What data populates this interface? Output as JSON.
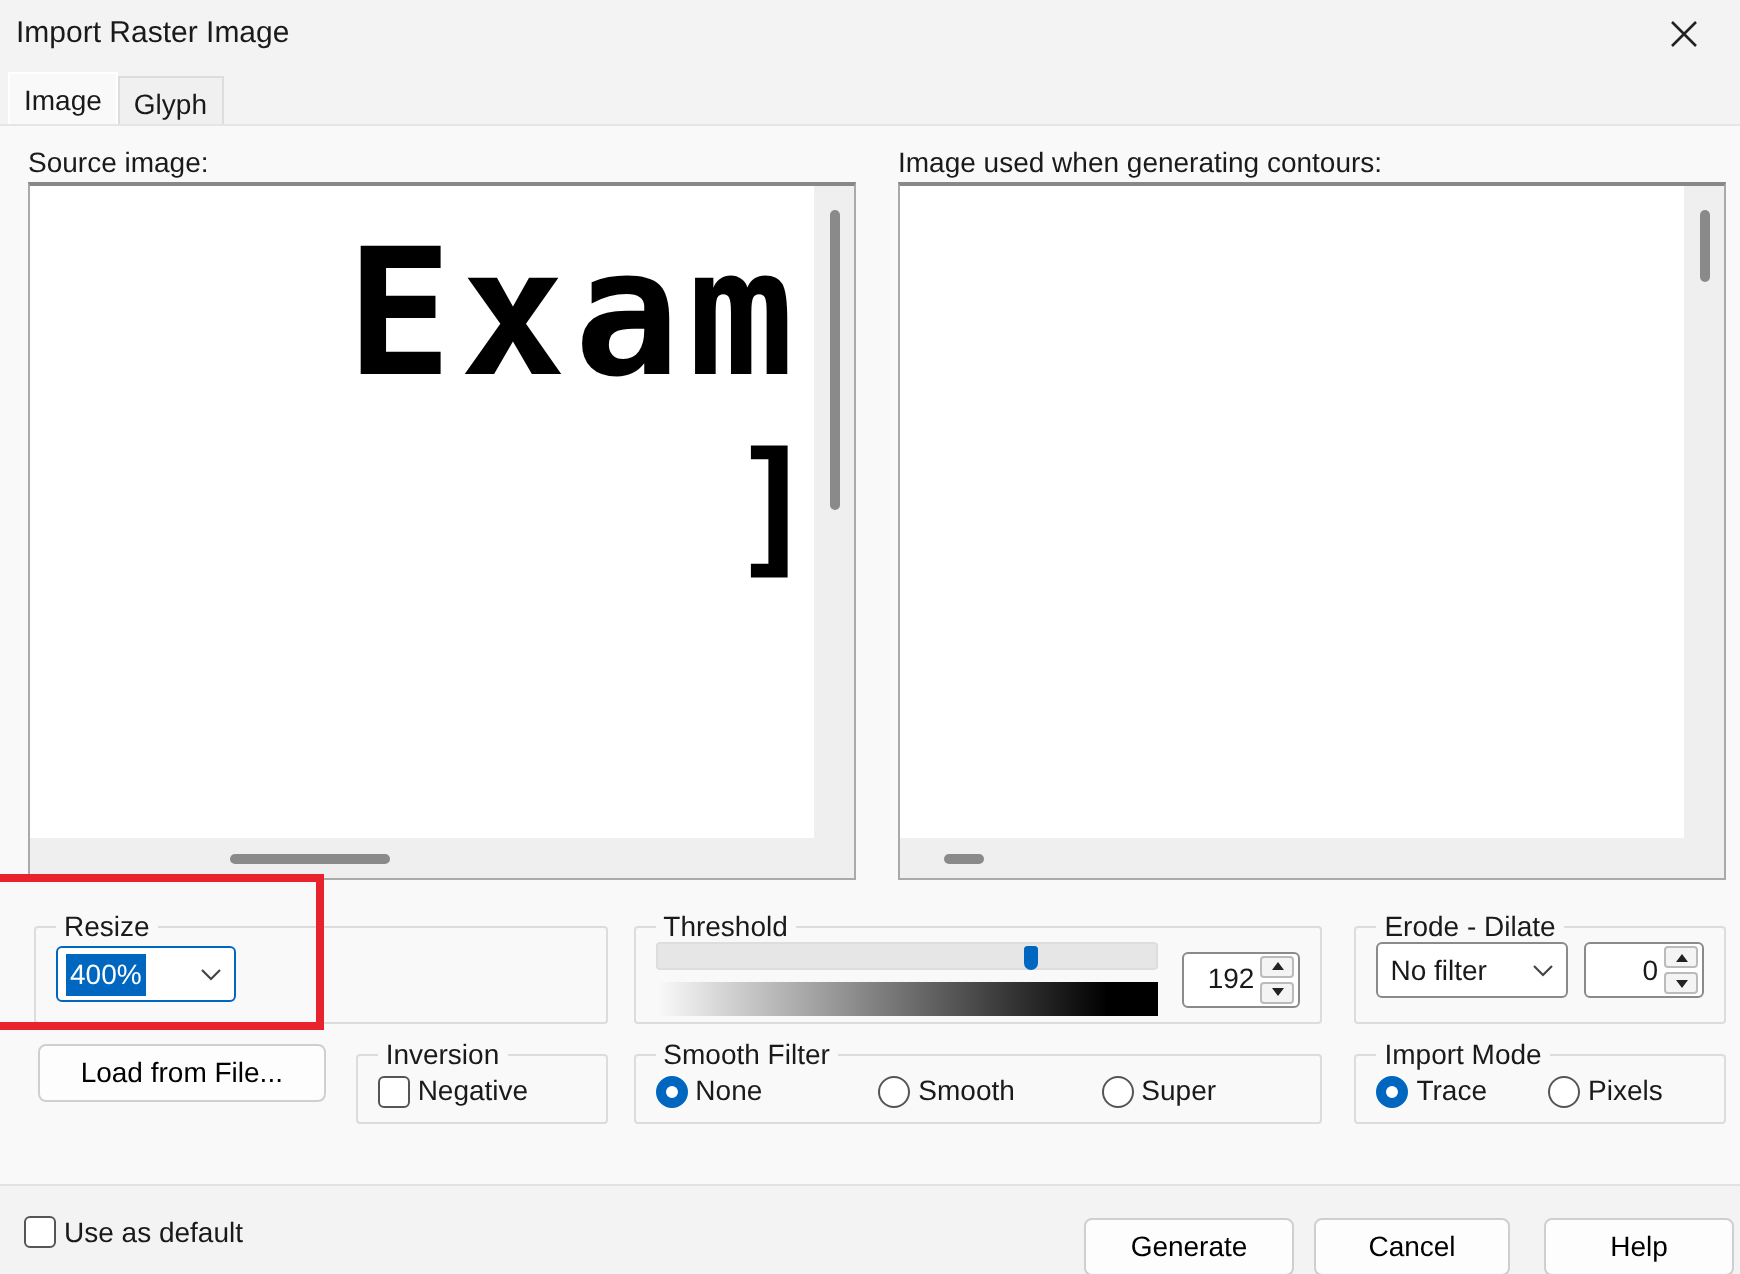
{
  "window": {
    "title": "Import Raster Image"
  },
  "tabs": [
    {
      "label": "Image",
      "selected": true
    },
    {
      "label": "Glyph",
      "selected": false
    }
  ],
  "previews": [
    {
      "label": "Source image:",
      "lines": [
        "Exam",
        "]"
      ]
    },
    {
      "label": "Image used when generating contours:"
    }
  ],
  "resize": {
    "label": "Resize",
    "value": "400%",
    "text_selected": true,
    "highlighted": true
  },
  "threshold": {
    "label": "Threshold",
    "level": 0.75,
    "value": "192"
  },
  "erode_dilate": {
    "label": "Erode - Dilate",
    "filter": "No filter",
    "value": "0"
  },
  "load_button": "Load from File...",
  "inversion": {
    "label": "Inversion",
    "options": [
      {
        "label": "Negative",
        "checked": false
      }
    ]
  },
  "smooth_filter": {
    "label": "Smooth Filter",
    "options": [
      {
        "label": "None",
        "selected": true
      },
      {
        "label": "Smooth",
        "selected": false
      },
      {
        "label": "Super",
        "selected": false
      }
    ]
  },
  "import_mode": {
    "label": "Import Mode",
    "options": [
      {
        "label": "Trace",
        "selected": true
      },
      {
        "label": "Pixels",
        "selected": false
      }
    ]
  },
  "use_as_default": {
    "label": "Use as default",
    "checked": false
  },
  "buttons": [
    "Generate",
    "Cancel",
    "Help"
  ]
}
